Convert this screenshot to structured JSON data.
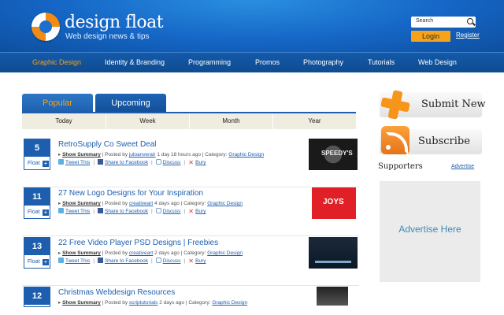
{
  "header": {
    "brand": "design float",
    "tagline": "Web design news & tips",
    "search_label": "Search",
    "login_label": "Login",
    "register_label": "Register",
    "logo_colors": [
      "#f28a16",
      "#ffffff"
    ]
  },
  "nav": {
    "items": [
      {
        "label": "Graphic Design",
        "active": true
      },
      {
        "label": "Identity & Branding"
      },
      {
        "label": "Programming"
      },
      {
        "label": "Promos"
      },
      {
        "label": "Photography"
      },
      {
        "label": "Tutorials"
      },
      {
        "label": "Web Design"
      }
    ],
    "active_color": "#f7a21b"
  },
  "tabs": [
    {
      "label": "Popular",
      "active": true
    },
    {
      "label": "Upcoming"
    }
  ],
  "periods": [
    "Today",
    "Week",
    "Month",
    "Year"
  ],
  "stories": [
    {
      "votes": "5",
      "float_label": "Float",
      "title": "RetroSupply Co Sweet Deal",
      "show_summary": "Show Summary",
      "posted_by": "Posted by",
      "author": "juloanverair",
      "time": "1 day 18 hours ago",
      "category_label": "Category:",
      "category": "Graphic Design",
      "thumb_text": "SPEEDY'S"
    },
    {
      "votes": "11",
      "float_label": "Float",
      "title": "27 New Logo Designs for Your Inspiration",
      "show_summary": "Show Summary",
      "posted_by": "Posted by",
      "author": "creativeart",
      "time": "4 days ago",
      "category_label": "Category:",
      "category": "Graphic Design",
      "thumb_text": "JOYS"
    },
    {
      "votes": "13",
      "float_label": "Float",
      "title": "22 Free Video Player PSD Designs | Freebies",
      "show_summary": "Show Summary",
      "posted_by": "Posted by",
      "author": "creativeart",
      "time": "2 days ago",
      "category_label": "Category:",
      "category": "Graphic Design"
    },
    {
      "votes": "12",
      "title": "Christmas Webdesign Resources",
      "show_summary": "Show Summary",
      "posted_by": "Posted by",
      "author": "scriptutorials",
      "time": "2 days ago",
      "category_label": "Category:",
      "category": "Graphic Design"
    }
  ],
  "actions": {
    "tweet": "Tweet This",
    "facebook": "Share to Facebook",
    "discuss": "Discuss",
    "bury": "Bury"
  },
  "sidebar": {
    "submit_label": "Submit New",
    "subscribe_label": "Subscribe",
    "supporters_label": "Supporters",
    "advertise_link": "Advertise",
    "ad_text": "Advertise Here"
  }
}
